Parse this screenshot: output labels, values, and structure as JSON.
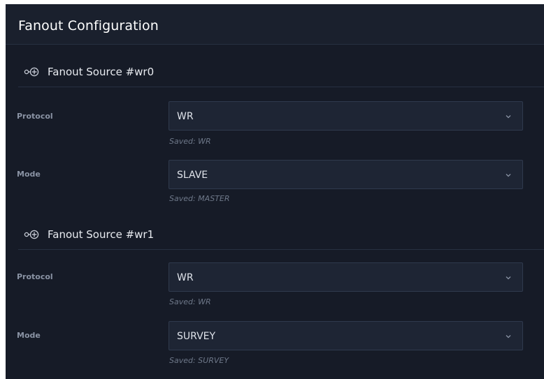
{
  "panel": {
    "title": "Fanout Configuration"
  },
  "sources": [
    {
      "title": "Fanout Source #wr0",
      "fields": [
        {
          "label": "Protocol",
          "value": "WR",
          "saved": "Saved: WR"
        },
        {
          "label": "Mode",
          "value": "SLAVE",
          "saved": "Saved: MASTER"
        }
      ]
    },
    {
      "title": "Fanout Source #wr1",
      "fields": [
        {
          "label": "Protocol",
          "value": "WR",
          "saved": "Saved: WR"
        },
        {
          "label": "Mode",
          "value": "SURVEY",
          "saved": "Saved: SURVEY"
        }
      ]
    }
  ],
  "colors": {
    "background": "#161b27",
    "select_background": "#1e2534",
    "border": "#2f3a4d",
    "label": "#8a93a4",
    "saved_hint": "#6e7889"
  },
  "icons": {
    "section": "link-add-icon",
    "dropdown": "chevron-down-icon"
  }
}
